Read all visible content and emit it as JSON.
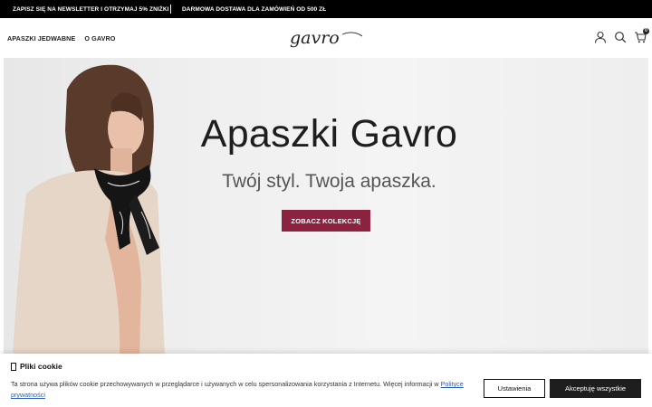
{
  "topbar": {
    "message_1": "ZAPISZ SIĘ NA NEWSLETTER I OTRZYMAJ 5% ZNIŻKI",
    "message_2": "DARMOWA DOSTAWA DLA ZAMÓWIEŃ OD 500 ZŁ"
  },
  "header": {
    "nav": [
      "APASZKI JEDWABNE",
      "O GAVRO"
    ],
    "logo": "gavro",
    "icons": [
      "user-icon",
      "search-icon",
      "cart-icon"
    ],
    "cart_count": "0"
  },
  "hero": {
    "title": "Apaszki Gavro",
    "subtitle": "Twój styl. Twoja apaszka.",
    "button": "ZOBACZ KOLEKCJĘ"
  },
  "cookie": {
    "title": "Pliki cookie",
    "text": "Ta strona używa plików cookie przechowywanych w przeglądarce i używanych w celu spersonalizowania korzystania z Internetu. Więcej informacji w ",
    "link": "Polityce prywatności",
    "settings_label": "Ustawienia",
    "accept_label": "Akceptuję wszystkie"
  },
  "colors": {
    "accent": "#8b2240",
    "topbar": "#000000",
    "dark_button": "#1e1e1e"
  }
}
